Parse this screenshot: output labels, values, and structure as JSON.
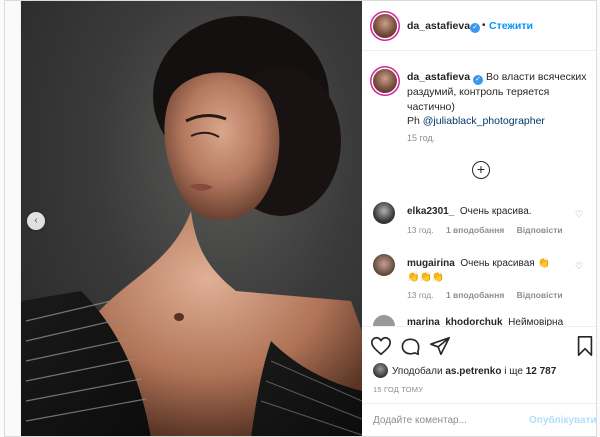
{
  "post": {
    "username": "da_astafieva",
    "follow_label": "Стежити",
    "separator": "•"
  },
  "caption": {
    "username": "da_astafieva",
    "text": "Во власти всяческих раздумий, контроль теряется частично)",
    "ph_prefix": "Ph ",
    "mention": "@juliablack_photographer",
    "time": "15 год."
  },
  "comments": [
    {
      "username": "elka2301_",
      "text": "Очень красива.",
      "time": "13 год.",
      "likes": "1 вподобання",
      "reply": "Відповісти"
    },
    {
      "username": "mugairina",
      "text": "Очень красивая 👏",
      "text2": "👏👏👏",
      "time": "13 год.",
      "likes": "1 вподобання",
      "reply": "Відповісти"
    },
    {
      "username": "marina_khodorchuk",
      "text": "Неймовірна"
    }
  ],
  "likes": {
    "prefix": "Уподобали ",
    "user": "as.petrenko",
    "middle": " і ще ",
    "count": "12 787"
  },
  "post_time": "15 ГОД ТОМУ",
  "add_comment": {
    "placeholder": "Додайте коментар...",
    "publish_label": "Опублікувати"
  },
  "colors": {
    "accent": "#0095f6",
    "verified": "#3897f0",
    "muted": "#8e8e8e",
    "publish_disabled": "#b2dffc"
  },
  "icons": [
    "chevron-left-icon",
    "verified-icon",
    "plus-circle-icon",
    "heart-icon",
    "comment-icon",
    "share-icon",
    "bookmark-icon"
  ]
}
